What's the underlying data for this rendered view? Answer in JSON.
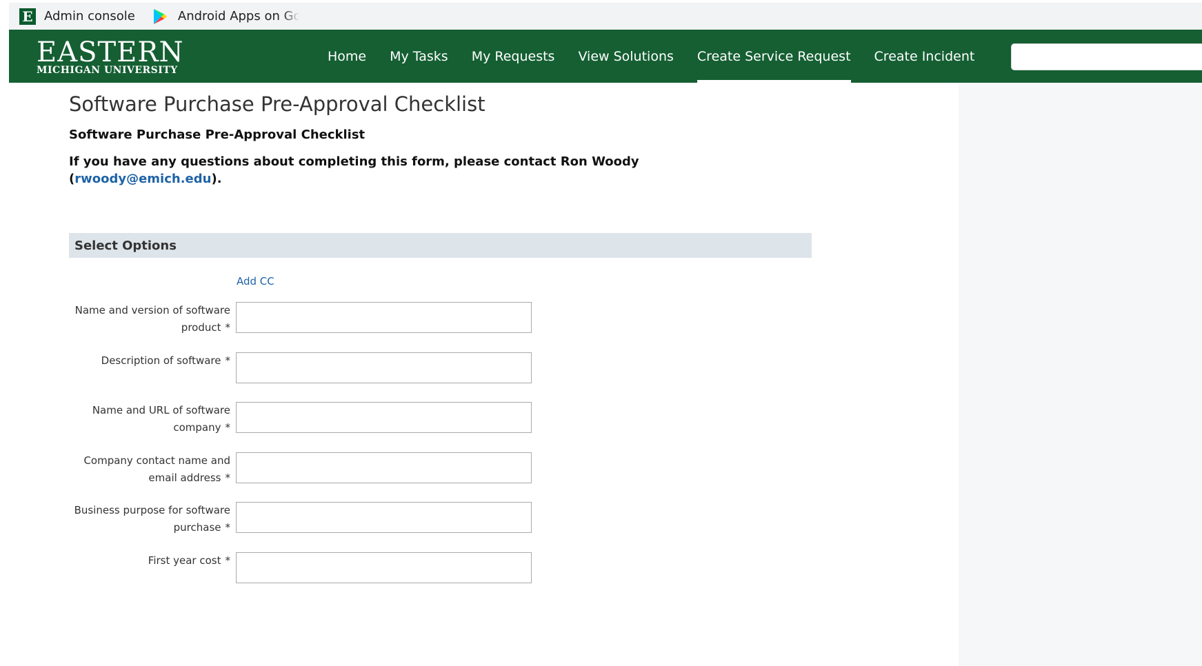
{
  "bookmarks": [
    {
      "label": "Admin console",
      "icon": "emu-e-icon"
    },
    {
      "label": "Android Apps on Goo",
      "icon": "google-play-icon"
    }
  ],
  "header": {
    "logo_top": "EASTERN",
    "logo_bottom": "MICHIGAN UNIVERSITY",
    "nav": [
      {
        "label": "Home"
      },
      {
        "label": "My Tasks"
      },
      {
        "label": "My Requests"
      },
      {
        "label": "View Solutions"
      },
      {
        "label": "Create Service Request",
        "active": true
      },
      {
        "label": "Create Incident"
      }
    ],
    "search_placeholder": ""
  },
  "main": {
    "title": "Software Purchase Pre-Approval Checklist",
    "subtitle": "Software Purchase Pre-Approval Checklist",
    "contact_text": "If you have any questions about completing this form, please contact Ron Woody (",
    "contact_email": "rwoody@emich.edu",
    "contact_tail": ").",
    "section_title": "Select Options",
    "add_cc": "Add CC",
    "fields": [
      {
        "label": "Name and version of software product",
        "required": "*",
        "value": ""
      },
      {
        "label": "Description of software",
        "required": "*",
        "value": ""
      },
      {
        "label": "Name and URL of software company",
        "required": "*",
        "value": ""
      },
      {
        "label": "Company contact name and email address",
        "required": "*",
        "value": ""
      },
      {
        "label": "Business purpose for software purchase",
        "required": "*",
        "value": ""
      },
      {
        "label": "First year cost",
        "required": "*",
        "value": ""
      }
    ]
  },
  "colors": {
    "header_green": "#155f33",
    "link_blue": "#1f63a6",
    "section_bar": "#dde4ea"
  }
}
